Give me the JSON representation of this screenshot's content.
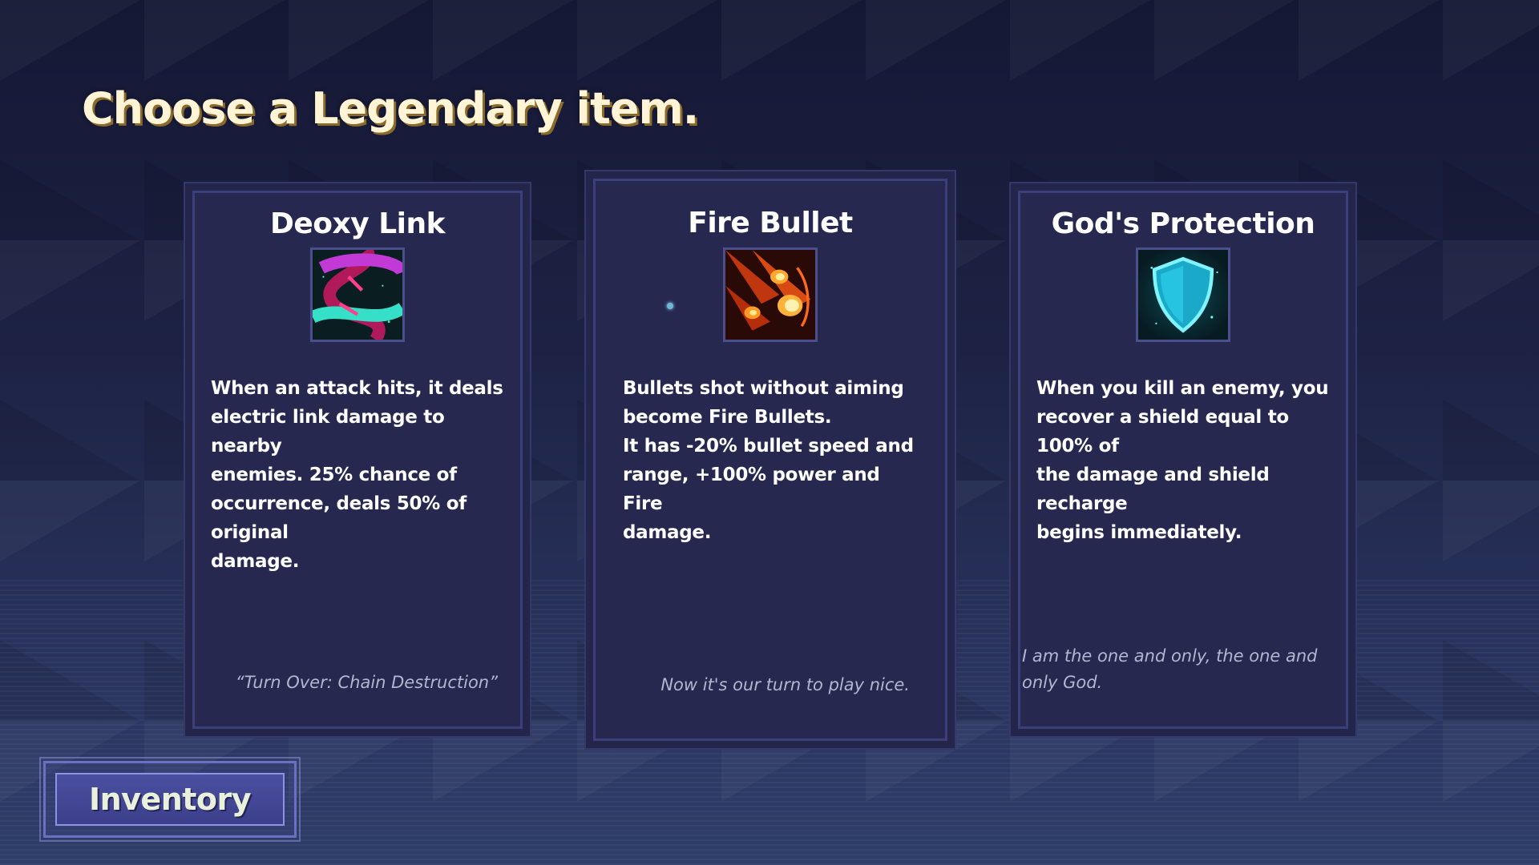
{
  "title": "Choose a Legendary item.",
  "cards": [
    {
      "name": "Deoxy Link",
      "icon": "dna-helix-icon",
      "description": "When an attack hits, it deals\nelectric link damage to nearby\nenemies. 25% chance of\noccurrence, deals 50% of original\ndamage.",
      "quote": "“Turn Over: Chain Destruction”"
    },
    {
      "name": "Fire Bullet",
      "icon": "fire-bullets-icon",
      "description": "Bullets shot without aiming\nbecome Fire Bullets.\nIt has -20% bullet speed and\nrange, +100% power and Fire\ndamage.",
      "quote": "Now it's our turn to play nice."
    },
    {
      "name": "God's Protection",
      "icon": "shield-icon",
      "description": "When you kill an enemy, you\nrecover a shield equal to 100% of\nthe damage and shield recharge\nbegins immediately.",
      "quote": "I am the one and only, the one and only\nGod."
    }
  ],
  "inventory_button": {
    "label": "Inventory"
  },
  "colors": {
    "card_bg": "#262850",
    "card_border": "#3b3f7a",
    "title_shadow": "#8a6a2a",
    "accent_cyan": "#2fd6e6",
    "fire_orange": "#ff8a1c"
  }
}
